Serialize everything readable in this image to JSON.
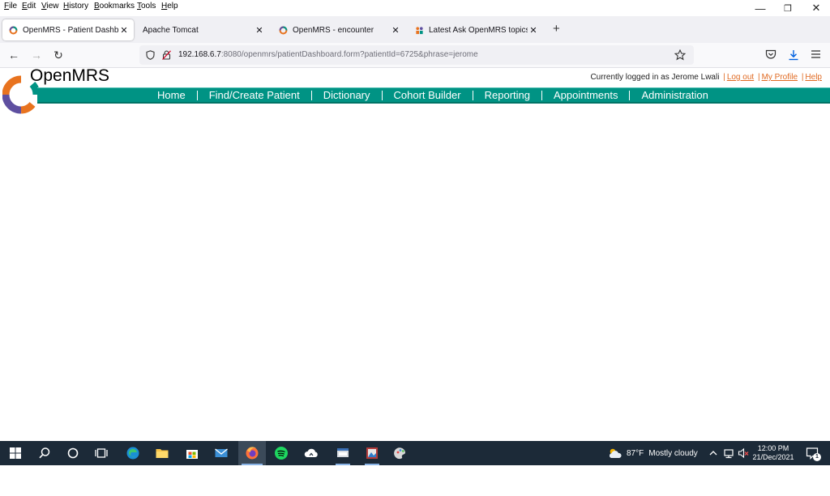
{
  "menubar": {
    "items": [
      "File",
      "Edit",
      "View",
      "History",
      "Bookmarks",
      "Tools",
      "Help"
    ]
  },
  "window_controls": {
    "minimize": "—",
    "restore": "❐",
    "close": "✕"
  },
  "tabs": [
    {
      "label": "OpenMRS - Patient Dashboard",
      "active": true,
      "icon": "openmrs-icon"
    },
    {
      "label": "Apache Tomcat",
      "active": false,
      "icon": "none"
    },
    {
      "label": "OpenMRS - encounter",
      "active": false,
      "icon": "openmrs-icon"
    },
    {
      "label": "Latest Ask OpenMRS topics - O|",
      "active": false,
      "icon": "community-icon"
    }
  ],
  "tab_close": "✕",
  "new_tab": "+",
  "nav": {
    "back": "←",
    "forward": "→",
    "reload": "↻"
  },
  "url": {
    "host": "192.168.6.7",
    "rest": ":8080/openmrs/patientDashboard.form?patientId=6725&phrase=jerome"
  },
  "header": {
    "brand": "OpenMRS",
    "logged_in_text": "Currently logged in as Jerome Lwali",
    "logout": "Log out",
    "my_profile": "My Profile",
    "help": "Help",
    "separator": "|"
  },
  "topnav": [
    "Home",
    "Find/Create Patient",
    "Dictionary",
    "Cohort Builder",
    "Reporting",
    "Appointments",
    "Administration"
  ],
  "colors": {
    "nav_bg": "#009384",
    "link_orange": "#e06a22",
    "taskbar": "#1c2a38"
  },
  "taskbar": {
    "weather": "87°F",
    "weather_desc": "Mostly cloudy",
    "time": "12:00 PM",
    "date": "21/Dec/2021",
    "notifications": "1"
  }
}
